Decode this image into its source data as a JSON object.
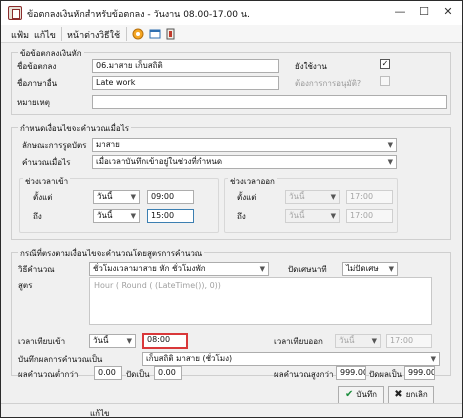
{
  "window": {
    "title": "ข้อตกลงเงินหักสำหรับข้อตกลง - วันงาน 08.00-17.00 น."
  },
  "menu": {
    "items": [
      "แฟ้ม",
      "แก้ไข",
      "หน้าต่าง",
      "วิธีใช้"
    ]
  },
  "general": {
    "title": "ข้อข้อตกลงเงินหัก",
    "name_label": "ชื่อข้อตกลง",
    "name_value": "06.มาสาย เก็บสถิติ",
    "eng_label": "ชื่อภาษาอื่น",
    "eng_value": "Late work",
    "note_label": "หมายเหตุ",
    "note_value": "",
    "active_label": "ยังใช้งาน",
    "active_checked": true,
    "approval_label": "ต้องการการอนุมัติ?",
    "approval_checked": false
  },
  "conditions": {
    "title": "กำหนดเงื่อนไขจะคำนวณเมื่อไร",
    "card_type_label": "ลักษณะการรูดบัตร",
    "card_type_value": "มาสาย",
    "calc_when_label": "คำนวณเมื่อไร",
    "calc_when_value": "เมื่อเวลาบันทึกเข้าอยู่ในช่วงที่กำหนด",
    "in_range": {
      "title": "ช่วงเวลาเข้า",
      "from_label": "ตั้งแต่",
      "to_label": "ถึง",
      "from_day": "วันนี้",
      "from_time": "09:00",
      "to_day": "วันนี้",
      "to_time": "15:00"
    },
    "out_range": {
      "title": "ช่วงเวลาออก",
      "from_label": "ตั้งแต่",
      "to_label": "ถึง",
      "from_day": "วันนี้",
      "from_time": "17:00",
      "to_day": "วันนี้",
      "to_time": "17:00"
    }
  },
  "formula": {
    "title": "กรณีที่ตรงตามเงื่อนไขจะคำนวณโดยสูตรการคำนวณ",
    "method_label": "วิธีคำนวณ",
    "method_value": "ชั่วโมงเวลามาสาย หัก ชั่วโมงพัก",
    "rounding_label": "ปัดเศษนาที",
    "rounding_value": "ไม่ปัดเศษ",
    "formula_label": "สูตร",
    "formula_value": "Hour ( Round ( (LateTime()), 0))",
    "compare_in_label": "เวลาเทียบเข้า",
    "compare_in_day": "วันนี้",
    "compare_in_time": "08:00",
    "compare_out_label": "เวลาเทียบออก",
    "compare_out_day": "วันนี้",
    "compare_out_time": "17:00",
    "save_as_label": "บันทึกผลการคำนวณเป็น",
    "save_as_value": "เก็บสถิติ มาสาย (ชั่วโมง)",
    "min_label": "ผลคำนวณต่ำกว่า",
    "min_value": "0.00",
    "min_round_label": "ปัดเป็น",
    "min_round_value": "0.00",
    "max_label": "ผลคำนวณสูงกว่า",
    "max_value": "999.00",
    "max_round_label": "ปัดผลเป็น",
    "max_round_value": "999.00"
  },
  "buttons": {
    "save": "บันทึก",
    "cancel": "ยกเลิก"
  },
  "status": {
    "text": "แก้ไข"
  }
}
